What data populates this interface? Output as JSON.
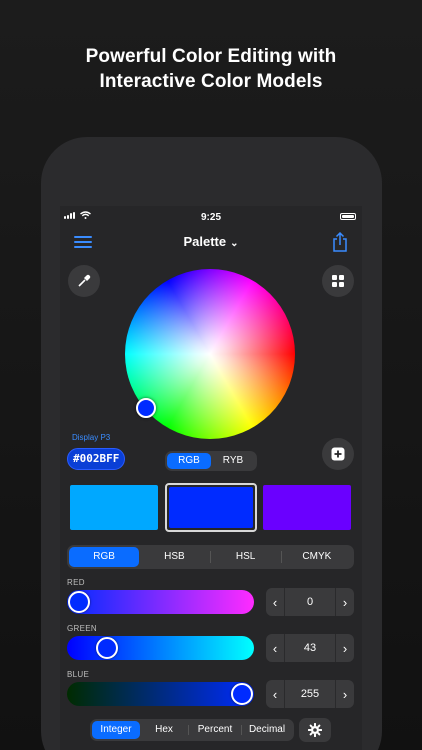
{
  "headline": {
    "line1": "Powerful Color Editing with",
    "line2": "Interactive Color Models"
  },
  "status": {
    "time": "9:25"
  },
  "nav": {
    "title": "Palette",
    "menu_icon": "hamburger-icon",
    "share_icon": "share-icon"
  },
  "picker": {
    "eyedropper_icon": "eyedropper-icon",
    "grid_icon": "grid-icon",
    "gamut_label": "Display P3",
    "hex_value": "#002BFF",
    "model_options": [
      "RGB",
      "RYB"
    ],
    "model_selected": "RGB",
    "add_icon": "plus-icon"
  },
  "palette": {
    "swatches": [
      "#00a8ff",
      "#002bff",
      "#6a00ff"
    ],
    "selected_index": 1
  },
  "tabs": {
    "options": [
      "RGB",
      "HSB",
      "HSL",
      "CMYK"
    ],
    "selected": "RGB"
  },
  "channels": [
    {
      "label": "RED",
      "value": "0",
      "fraction": 0.0
    },
    {
      "label": "GREEN",
      "value": "43",
      "fraction": 0.169
    },
    {
      "label": "BLUE",
      "value": "255",
      "fraction": 1.0
    }
  ],
  "format": {
    "options": [
      "Integer",
      "Hex",
      "Percent",
      "Decimal"
    ],
    "selected": "Integer",
    "settings_icon": "gear-icon"
  },
  "colors": {
    "accent": "#0a6cff",
    "selected_color": "#002bff"
  }
}
